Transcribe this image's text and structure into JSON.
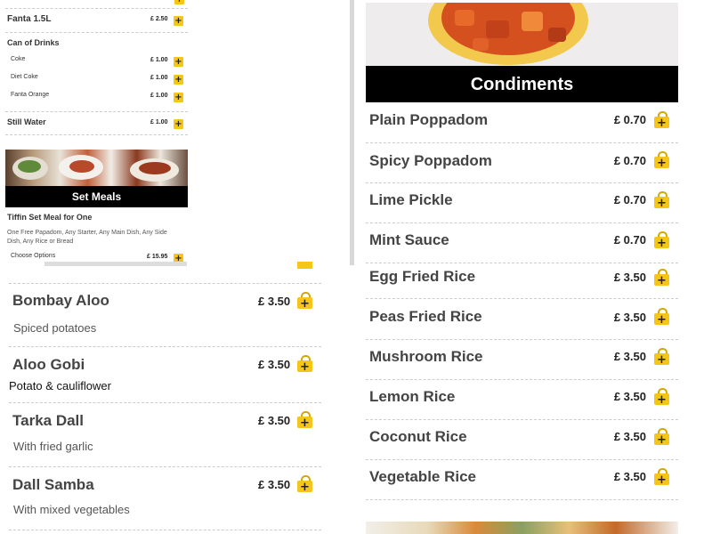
{
  "left_panel": {
    "drink_rows": [
      {
        "name": "Fanta 1.5L",
        "price": "£ 2.50"
      }
    ],
    "can_heading": "Can of Drinks",
    "can_items": [
      {
        "name": "Coke",
        "price": "£ 1.00"
      },
      {
        "name": "Diet Coke",
        "price": "£ 1.00"
      },
      {
        "name": "Fanta Orange",
        "price": "£ 1.00"
      }
    ],
    "water": {
      "name": "Still Water",
      "price": "£ 1.00"
    },
    "set_meals_banner": "Set Meals",
    "tiffin": {
      "title": "Tiffin Set Meal for One",
      "description": "One Free Papadom, Any Starter, Any Main Dish, Any Side Dish, Any Rice or Bread",
      "choose": "Choose Options",
      "price": "£ 15.95"
    }
  },
  "side_dishes": [
    {
      "name": "Bombay Aloo",
      "price": "£ 3.50",
      "description": "Spiced potatoes"
    },
    {
      "name": "Aloo Gobi",
      "price": "£ 3.50",
      "description": "Potato & cauliflower"
    },
    {
      "name": "Tarka Dall",
      "price": "£ 3.50",
      "description": "With fried garlic"
    },
    {
      "name": "Dall Samba",
      "price": "£ 3.50",
      "description": "With mixed vegetables"
    }
  ],
  "condiments": {
    "banner": "Condiments",
    "items": [
      {
        "name": "Plain Poppadom",
        "price": "£ 0.70"
      },
      {
        "name": "Spicy Poppadom",
        "price": "£ 0.70"
      },
      {
        "name": "Lime Pickle",
        "price": "£ 0.70"
      },
      {
        "name": "Mint Sauce",
        "price": "£ 0.70"
      },
      {
        "name": "Egg Fried Rice",
        "price": "£ 3.50"
      },
      {
        "name": "Peas Fried Rice",
        "price": "£ 3.50"
      },
      {
        "name": "Mushroom Rice",
        "price": "£ 3.50"
      },
      {
        "name": "Lemon Rice",
        "price": "£ 3.50"
      },
      {
        "name": "Coconut Rice",
        "price": "£ 3.50"
      },
      {
        "name": "Vegetable Rice",
        "price": "£ 3.50"
      }
    ]
  },
  "colors": {
    "accent": "#f5c518",
    "banner": "#000000"
  },
  "icons": {
    "add": "add-to-bag-icon"
  }
}
